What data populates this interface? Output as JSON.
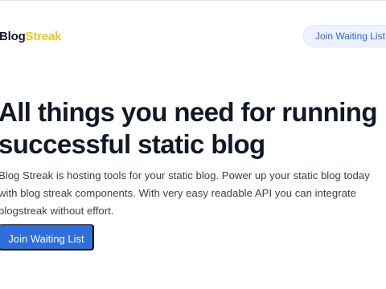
{
  "header": {
    "logo": {
      "part1": "Blog",
      "part2": "Streak"
    },
    "cta_label": "Join Waiting List →"
  },
  "hero": {
    "title": "All things you need for running successful static blog",
    "description": "Blog Streak is hosting tools for your static blog. Power up your static blog today with blog streak components. With very easy readable API you can integrate blogstreak without effort.",
    "cta_label": "Join Waiting List"
  },
  "colors": {
    "accent": "#2f6fdc",
    "logo_highlight": "#f5c518",
    "header_cta_bg": "#eef2ff",
    "text": "#111827"
  }
}
